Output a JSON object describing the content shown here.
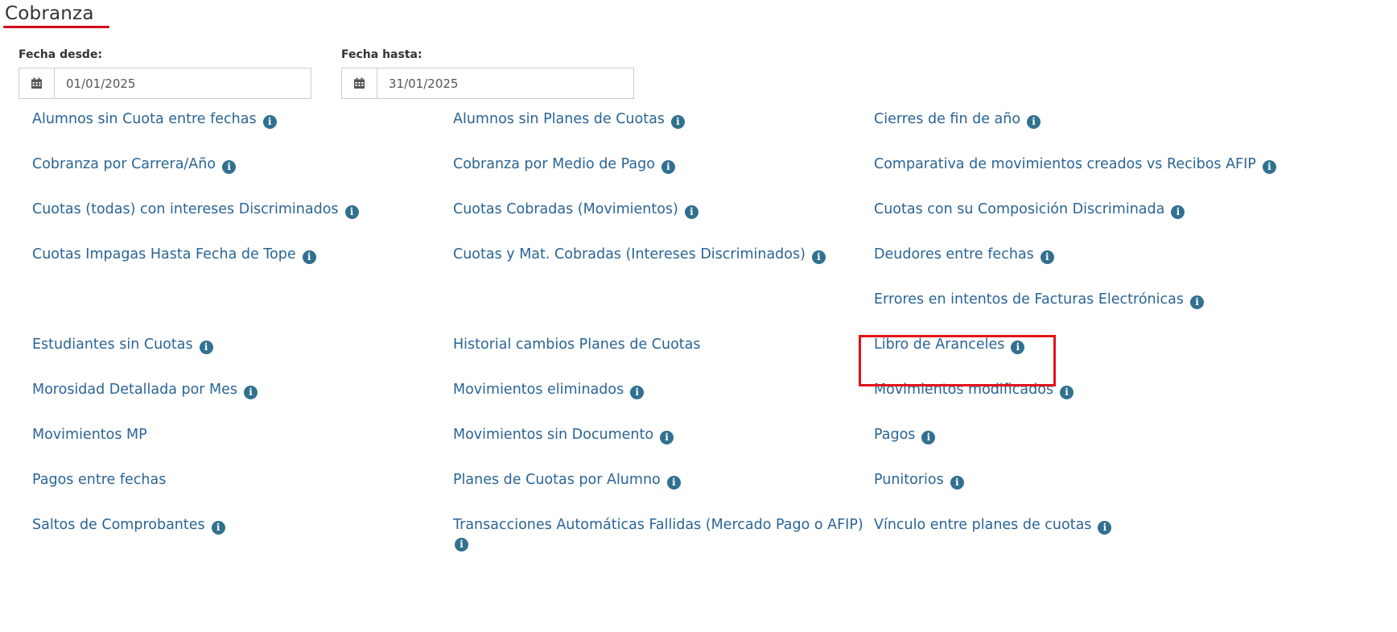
{
  "header": {
    "title": "Cobranza"
  },
  "filters": {
    "desde": {
      "label": "Fecha desde:",
      "value": "01/01/2025"
    },
    "hasta": {
      "label": "Fecha hasta:",
      "value": "31/01/2025"
    }
  },
  "reports": [
    {
      "label": "Alumnos sin Cuota entre fechas",
      "info": true
    },
    {
      "label": "Alumnos sin Planes de Cuotas",
      "info": true
    },
    {
      "label": "Cierres de fin de año",
      "info": true
    },
    {
      "label": "Cobranza por Carrera/Año",
      "info": true
    },
    {
      "label": "Cobranza por Medio de Pago",
      "info": true
    },
    {
      "label": "Comparativa de movimientos creados vs Recibos AFIP",
      "info": true
    },
    {
      "label": "Cuotas (todas) con intereses Discriminados",
      "info": true
    },
    {
      "label": "Cuotas Cobradas (Movimientos)",
      "info": true
    },
    {
      "label": "Cuotas con su Composición Discriminada",
      "info": true
    },
    {
      "label": "Cuotas Impagas Hasta Fecha de Tope",
      "info": true
    },
    {
      "label": "Cuotas y Mat. Cobradas (Intereses Discriminados)",
      "info": true
    },
    {
      "label": "Deudores entre fechas",
      "info": true
    },
    {
      "label": "",
      "info": false
    },
    {
      "label": "",
      "info": false
    },
    {
      "label": "Errores en intentos de Facturas Electrónicas",
      "info": true
    },
    {
      "label": "Estudiantes sin Cuotas",
      "info": true
    },
    {
      "label": "Historial cambios Planes de Cuotas",
      "info": false
    },
    {
      "label": "Libro de Aranceles",
      "info": true
    },
    {
      "label": "Morosidad Detallada por Mes",
      "info": true
    },
    {
      "label": "Movimientos eliminados",
      "info": true
    },
    {
      "label": "Movimientos modificados",
      "info": true
    },
    {
      "label": "Movimientos MP",
      "info": false
    },
    {
      "label": "Movimientos sin Documento",
      "info": true
    },
    {
      "label": "Pagos",
      "info": true
    },
    {
      "label": "Pagos entre fechas",
      "info": false
    },
    {
      "label": "Planes de Cuotas por Alumno",
      "info": true
    },
    {
      "label": "Punitorios",
      "info": true
    },
    {
      "label": "Saltos de Comprobantes",
      "info": true
    },
    {
      "label": "Transacciones Automáticas Fallidas (Mercado Pago o AFIP)",
      "info": true
    },
    {
      "label": "Vínculo entre planes de cuotas",
      "info": true
    }
  ]
}
